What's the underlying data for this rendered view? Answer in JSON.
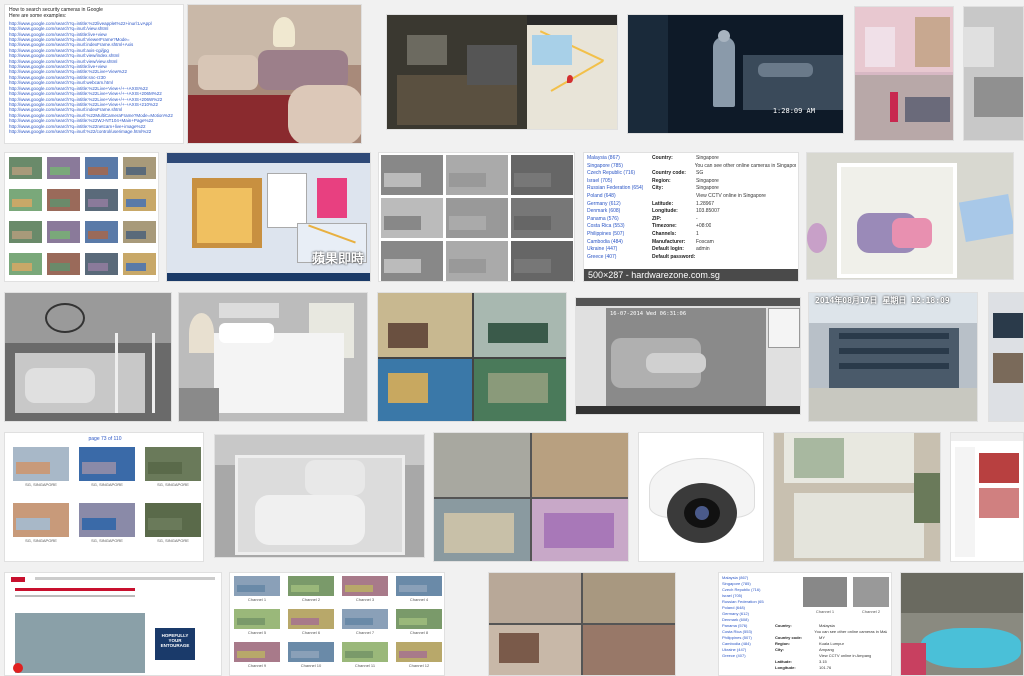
{
  "tiles": {
    "google_how_to": {
      "heading": "How to search security cameras in Google",
      "subheading": "Here are some examples:",
      "links": [
        "http://www.google.com/search?q=intitle:%22liveapplet%22+inurl:LvAppl",
        "http://www.google.com/search?q=inurl:/view.shtml",
        "http://www.google.com/search?q=intitle:live+view",
        "http://www.google.com/search?q=inurl:ViewerFrame?Mode=",
        "http://www.google.com/search?q=inurl:indexFrame.shtml+Axis",
        "http://www.google.com/search?q=inurl:axis-cgi/jpg",
        "http://www.google.com/search?q=inurl:view/index.shtml",
        "http://www.google.com/search?q=inurl:view/view.shtml",
        "http://www.google.com/search?q=intitle:live+view",
        "http://www.google.com/search?q=intitle:%22Live+View%22",
        "http://www.google.com/search?q=intitle:snc-rz30",
        "http://www.google.com/search?q=inurl:webcam.html",
        "http://www.google.com/search?q=intitle:%22Live+View+/+-+AXIS%22",
        "http://www.google.com/search?q=intitle:%22Live+View+/+-+AXIS+206M%22",
        "http://www.google.com/search?q=intitle:%22Live+View+/+-+AXIS+206W%22",
        "http://www.google.com/search?q=intitle:%22Live+View+/+-+AXIS+210%22",
        "http://www.google.com/search?q=inurl:indexFrame.shtml",
        "http://www.google.com/search?q=inurl:%22MultiCameraFrame?Mode=Motion%22",
        "http://www.google.com/search?q=intitle:%22WJ-NT104+Main+Page%22",
        "http://www.google.com/search?q=intitle:%22netcam+live+image%22",
        "http://www.google.com/search?q=inurl:%22/control/userimage.html%22"
      ]
    },
    "bedroom_timestamp": "1:28:09 AM",
    "country_list": [
      "Malaysia (867)",
      "Singapore (785)",
      "Czech Republic (716)",
      "Israel (705)",
      "Russian Federation (654)",
      "Poland (648)",
      "Germany (612)",
      "Denmark (608)",
      "Panama (576)",
      "Costa Rica (553)",
      "Philippines (507)",
      "Cambodia (484)",
      "Ukraine (447)",
      "Greece (407)"
    ],
    "singapore_info": {
      "rows": [
        {
          "k": "Country:",
          "v": "Singapore"
        },
        {
          "k": "",
          "v": "You can see other online cameras in Singapore"
        },
        {
          "k": "Country code:",
          "v": "SG"
        },
        {
          "k": "Region:",
          "v": "Singapore"
        },
        {
          "k": "City:",
          "v": "Singapore"
        },
        {
          "k": "",
          "v": "View CCTV online in Singapore"
        },
        {
          "k": "Latitude:",
          "v": "1.28967"
        },
        {
          "k": "Longitude:",
          "v": "103.85007"
        },
        {
          "k": "ZIP:",
          "v": "-"
        },
        {
          "k": "Timezone:",
          "v": "+08:00"
        },
        {
          "k": "Channels:",
          "v": "1"
        },
        {
          "k": "Manufacturer:",
          "v": "Foscam"
        },
        {
          "k": "Default login:",
          "v": "admin"
        },
        {
          "k": "Default password:",
          "v": ""
        }
      ],
      "caption": "500×287 - hardwarezone.com.sg"
    },
    "chinese_overlay": "蘋果即時",
    "baby_timestamp": "16-07-2014 Wed 06:31:06",
    "office_timestamp": "2014年08月17日  星期日  12:18:09",
    "sg_labels": [
      "SG, SINGAPORE",
      "SG, SINGAPORE",
      "SG, SINGAPORE",
      "SG, SINGAPORE",
      "SG, SINGAPORE",
      "SG, SINGAPORE"
    ],
    "sg_pager": "page 73 of 110",
    "entourage_text": "HOPEFULLY YOUR ENTOURAGE",
    "channel_labels": [
      "Channel 1",
      "Channel 2",
      "Channel 3",
      "Channel 4",
      "Channel 5",
      "Channel 6",
      "Channel 7",
      "Channel 8",
      "Channel 9",
      "Channel 10",
      "Channel 11",
      "Channel 12"
    ],
    "country_list_2": [
      "Malaysia (867)",
      "Singapore (785)",
      "Czech Republic (716)",
      "Israel (705)",
      "Russian Federation (654)",
      "Poland (648)",
      "Germany (612)",
      "Denmark (608)",
      "Panama (576)",
      "Costa Rica (553)",
      "Philippines (507)",
      "Cambodia (484)",
      "Ukraine (447)",
      "Greece (407)"
    ],
    "macau_info": [
      {
        "k": "Country:",
        "v": "Malaysia"
      },
      {
        "k": "",
        "v": "You can see other online cameras in Malaysia"
      },
      {
        "k": "Country code:",
        "v": "MY"
      },
      {
        "k": "Region:",
        "v": "Kuala Lumpur"
      },
      {
        "k": "City:",
        "v": "Ampang"
      },
      {
        "k": "",
        "v": "View CCTV online in Ampang"
      },
      {
        "k": "Latitude:",
        "v": "3.15"
      },
      {
        "k": "Longitude:",
        "v": "101.76"
      }
    ]
  }
}
